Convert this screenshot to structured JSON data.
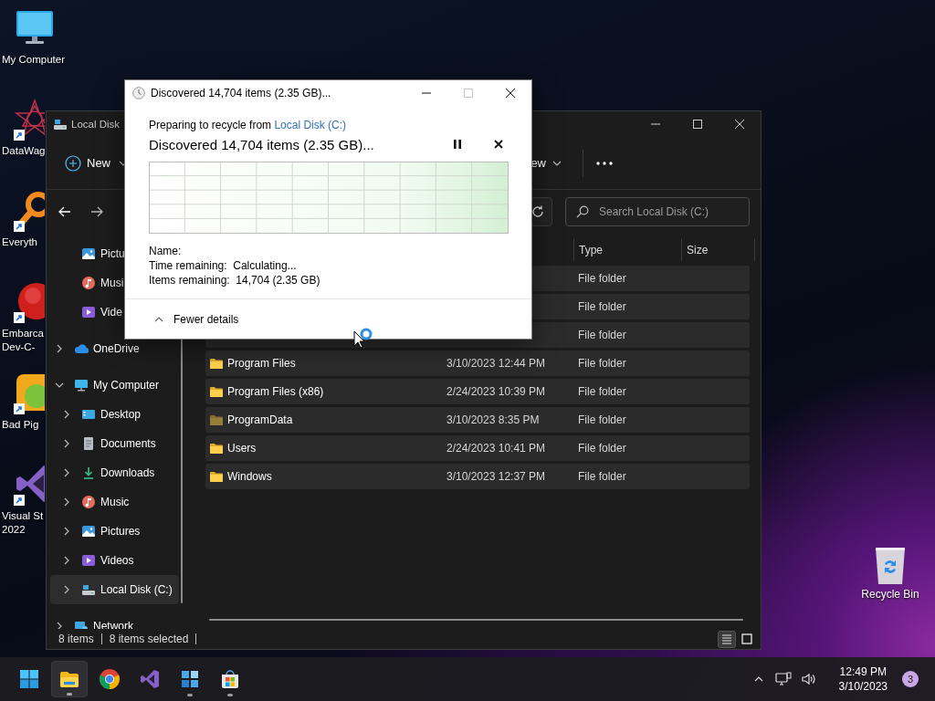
{
  "desktop_icons": [
    {
      "kind": "monitor",
      "lines": [
        "My Computer"
      ],
      "shortcut": false
    },
    {
      "kind": "star",
      "lines": [
        "DataWag"
      ],
      "shortcut": true
    },
    {
      "kind": "magnifier",
      "lines": [
        "Everyth"
      ],
      "shortcut": true
    },
    {
      "kind": "devcpp",
      "lines": [
        "Embarca",
        "Dev-C-"
      ],
      "shortcut": true
    },
    {
      "kind": "game",
      "lines": [
        "Bad Pig"
      ],
      "shortcut": true
    },
    {
      "kind": "vs",
      "lines": [
        "Visual St",
        "2022"
      ],
      "shortcut": true
    }
  ],
  "recycle_bin": {
    "label": "Recycle Bin"
  },
  "explorer": {
    "title": "Local Disk",
    "toolbar": {
      "new": "New",
      "view": "ew"
    },
    "search": {
      "placeholder": "Search Local Disk (C:)"
    },
    "quick_access": [
      {
        "label": "Pictu",
        "kind": "pictures",
        "selected": false
      },
      {
        "label": "Musi",
        "kind": "music",
        "selected": false
      },
      {
        "label": "Vide",
        "kind": "videos",
        "selected": false
      }
    ],
    "tree": [
      {
        "label": "OneDrive",
        "kind": "onedrive",
        "expanded": false,
        "selected": false
      },
      {
        "label": "My Computer",
        "kind": "computer",
        "expanded": true,
        "selected": false,
        "children": [
          {
            "label": "Desktop",
            "kind": "desktop",
            "expanded": false,
            "selected": false
          },
          {
            "label": "Documents",
            "kind": "documents",
            "expanded": false,
            "selected": false
          },
          {
            "label": "Downloads",
            "kind": "downloads",
            "expanded": false,
            "selected": false
          },
          {
            "label": "Music",
            "kind": "music",
            "expanded": false,
            "selected": false
          },
          {
            "label": "Pictures",
            "kind": "pictures",
            "expanded": false,
            "selected": false
          },
          {
            "label": "Videos",
            "kind": "videos",
            "expanded": false,
            "selected": false
          },
          {
            "label": "Local Disk (C:)",
            "kind": "drive",
            "expanded": false,
            "selected": true
          }
        ]
      },
      {
        "label": "Network",
        "kind": "network",
        "expanded": false,
        "selected": false
      }
    ],
    "columns": [
      "Type",
      "Size"
    ],
    "rows": [
      {
        "type": "File folder",
        "selected": true
      },
      {
        "type": "File folder",
        "selected": true
      },
      {
        "type": "File folder",
        "selected": true
      },
      {
        "name": "Program Files",
        "date": "3/10/2023 12:44 PM",
        "type": "File folder",
        "selected": true,
        "hidden": false
      },
      {
        "name": "Program Files (x86)",
        "date": "2/24/2023 10:39 PM",
        "type": "File folder",
        "selected": true,
        "hidden": false
      },
      {
        "name": "ProgramData",
        "date": "3/10/2023 8:35 PM",
        "type": "File folder",
        "selected": true,
        "hidden": true
      },
      {
        "name": "Users",
        "date": "2/24/2023 10:41 PM",
        "type": "File folder",
        "selected": true,
        "hidden": false
      },
      {
        "name": "Windows",
        "date": "3/10/2023 12:37 PM",
        "type": "File folder",
        "selected": true,
        "hidden": false
      }
    ],
    "status": {
      "count": "8 items",
      "selection": "8 items selected"
    },
    "views": [
      {
        "kind": "details",
        "selected": true
      },
      {
        "kind": "tiles",
        "selected": false
      }
    ]
  },
  "dialog": {
    "title": "Discovered 14,704 items (2.35 GB)...",
    "maximize_disabled": true,
    "source_prefix": "Preparing to recycle from ",
    "source_link": "Local Disk (C:)",
    "heading": "Discovered 14,704 items (2.35 GB)...",
    "details": [
      {
        "label": "Name:"
      },
      {
        "label": "Time remaining:",
        "value": "Calculating..."
      },
      {
        "label": "Items remaining:",
        "value": "14,704 (2.35 GB)"
      }
    ],
    "toggle": "Fewer details"
  },
  "taskbar": {
    "apps": [
      {
        "kind": "start",
        "active": false,
        "running": false
      },
      {
        "kind": "explorer",
        "active": true,
        "running": true
      },
      {
        "kind": "chrome",
        "active": false,
        "running": false
      },
      {
        "kind": "vs",
        "active": false,
        "running": false
      },
      {
        "kind": "tiles",
        "active": false,
        "running": true
      },
      {
        "kind": "store",
        "active": false,
        "running": true
      }
    ],
    "time": "12:49 PM",
    "date": "3/10/2023",
    "notifications": "3"
  }
}
